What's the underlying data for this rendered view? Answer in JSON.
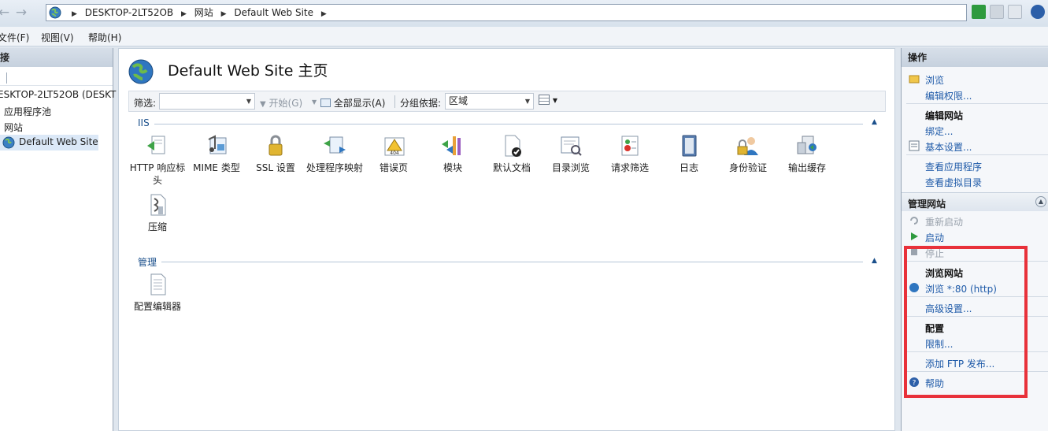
{
  "address_bar": {
    "breadcrumbs": [
      "DESKTOP-2LT52OB",
      "网站",
      "Default Web Site"
    ]
  },
  "menu": {
    "items": [
      "文件(F)",
      "视图(V)",
      "帮助(H)"
    ]
  },
  "connections": {
    "title": "接",
    "tree": [
      {
        "label": "ESKTOP-2LT52OB (DESKT"
      },
      {
        "label": "应用程序池"
      },
      {
        "label": "网站"
      },
      {
        "label": "Default Web Site"
      }
    ]
  },
  "center": {
    "title": "Default Web Site 主页",
    "filter": {
      "label": "筛选:",
      "value": "",
      "start_label": "开始(G)",
      "show_all_label": "全部显示(A)",
      "group_by_label": "分组依据:",
      "group_by_value": "区域"
    },
    "sections": [
      {
        "name": "IIS",
        "features": [
          {
            "label": "HTTP 响应标头",
            "icon": "http-response-headers-icon"
          },
          {
            "label": "MIME 类型",
            "icon": "mime-types-icon"
          },
          {
            "label": "SSL 设置",
            "icon": "ssl-settings-icon"
          },
          {
            "label": "处理程序映射",
            "icon": "handler-mappings-icon"
          },
          {
            "label": "错误页",
            "icon": "error-pages-icon"
          },
          {
            "label": "模块",
            "icon": "modules-icon"
          },
          {
            "label": "默认文档",
            "icon": "default-document-icon"
          },
          {
            "label": "目录浏览",
            "icon": "directory-browsing-icon"
          },
          {
            "label": "请求筛选",
            "icon": "request-filtering-icon"
          },
          {
            "label": "日志",
            "icon": "logging-icon"
          },
          {
            "label": "身份验证",
            "icon": "authentication-icon"
          },
          {
            "label": "输出缓存",
            "icon": "output-caching-icon"
          },
          {
            "label": "压缩",
            "icon": "compression-icon"
          }
        ]
      },
      {
        "name": "管理",
        "features": [
          {
            "label": "配置编辑器",
            "icon": "configuration-editor-icon"
          }
        ]
      }
    ]
  },
  "actions": {
    "title": "操作",
    "browse": "浏览",
    "edit_permissions": "编辑权限...",
    "edit_site_group": "编辑网站",
    "bindings": "绑定...",
    "basic_settings": "基本设置...",
    "view_app_pools": "查看应用程序",
    "view_virtual_dirs": "查看虚拟目录",
    "manage_site_group": "管理网站",
    "restart": "重新启动",
    "start": "启动",
    "stop": "停止",
    "browse_site_group": "浏览网站",
    "browse_http": "浏览 *:80 (http)",
    "advanced_settings": "高级设置...",
    "config_group": "配置",
    "limits": "限制...",
    "add_ftp": "添加 FTP 发布...",
    "help": "帮助"
  },
  "colors": {
    "link": "#1e5aa8",
    "highlight_box": "#e8313a"
  }
}
